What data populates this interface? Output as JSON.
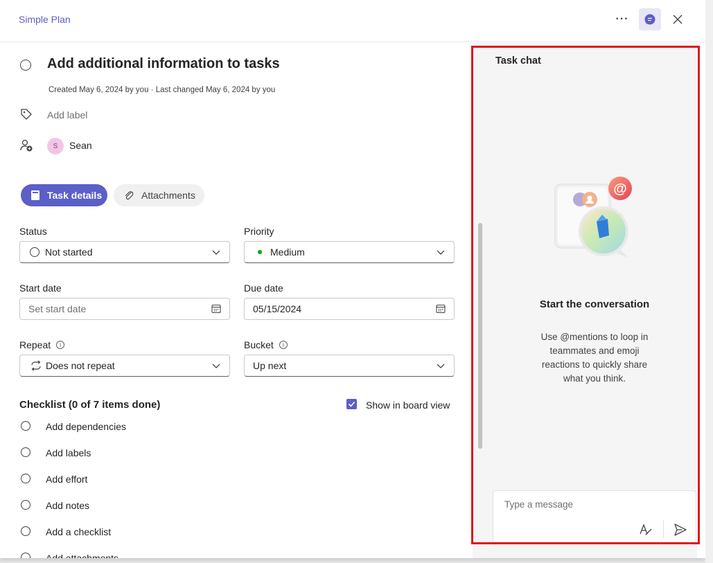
{
  "header": {
    "plan_name": "Simple Plan",
    "more_label": "···"
  },
  "task": {
    "title": "Add additional information to tasks",
    "meta": "Created May 6, 2024 by you · Last changed May 6, 2024 by you",
    "add_label": "Add label",
    "assignee_initial": "S",
    "assignee_name": "Sean"
  },
  "tabs": [
    {
      "label": "Task details",
      "active": true
    },
    {
      "label": "Attachments",
      "active": false
    }
  ],
  "fields": {
    "status": {
      "label": "Status",
      "value": "Not started"
    },
    "priority": {
      "label": "Priority",
      "value": "Medium",
      "color": "#13a10e"
    },
    "start_date": {
      "label": "Start date",
      "placeholder": "Set start date"
    },
    "due_date": {
      "label": "Due date",
      "value": "05/15/2024"
    },
    "repeat": {
      "label": "Repeat",
      "value": "Does not repeat"
    },
    "bucket": {
      "label": "Bucket",
      "value": "Up next"
    }
  },
  "checklist": {
    "title": "Checklist (0 of 7 items done)",
    "show_in_board": "Show in board view",
    "show_in_board_checked": true,
    "items": [
      "Add dependencies",
      "Add labels",
      "Add effort",
      "Add notes",
      "Add a checklist",
      "Add attachments"
    ]
  },
  "chat": {
    "title": "Task chat",
    "heading": "Start the conversation",
    "description": "Use @mentions to loop in teammates and emoji reactions to quickly share what you think.",
    "message_placeholder": "Type a message"
  },
  "colors": {
    "accent": "#5b5fc7",
    "highlight": "#e0161b"
  }
}
